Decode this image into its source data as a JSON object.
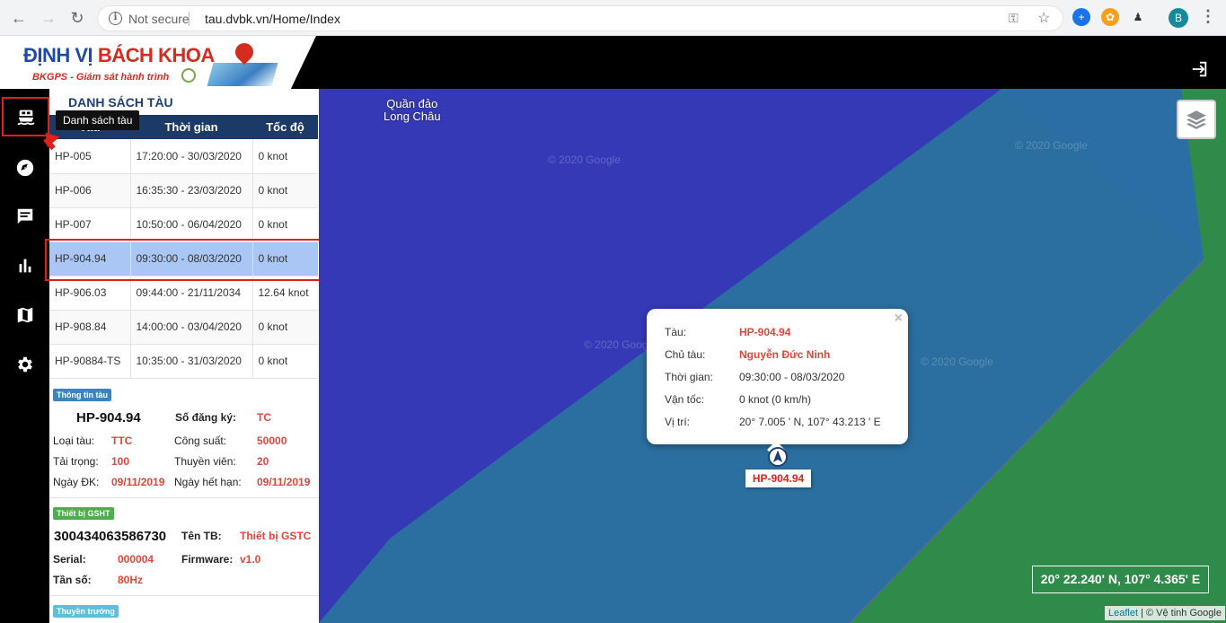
{
  "browser": {
    "security_label": "Not secure",
    "url": "tau.dvbk.vn/Home/Index",
    "avatar_letter": "B"
  },
  "header": {
    "logo_title_1": "ĐỊNH VỊ",
    "logo_title_2": "BÁCH KHOA",
    "logo_subtitle": "BKGPS - Giám sát hành trình"
  },
  "sidebar": {
    "tooltip": "Danh sách tàu",
    "items": [
      {
        "icon": "ship-icon",
        "active": true
      },
      {
        "icon": "compass-icon",
        "active": false
      },
      {
        "icon": "message-icon",
        "active": false
      },
      {
        "icon": "bar-chart-icon",
        "active": false
      },
      {
        "icon": "map-icon",
        "active": false
      },
      {
        "icon": "gear-icon",
        "active": false
      }
    ]
  },
  "ship_list": {
    "title": "DANH SÁCH TÀU",
    "columns": [
      "Tàu",
      "Thời gian",
      "Tốc độ"
    ],
    "rows": [
      {
        "name": "HP-005",
        "time": "17:20:00 - 30/03/2020",
        "speed": "0 knot"
      },
      {
        "name": "HP-006",
        "time": "16:35:30 - 23/03/2020",
        "speed": "0 knot"
      },
      {
        "name": "HP-007",
        "time": "10:50:00 - 06/04/2020",
        "speed": "0 knot"
      },
      {
        "name": "HP-904.94",
        "time": "09:30:00 - 08/03/2020",
        "speed": "0 knot",
        "selected": true
      },
      {
        "name": "HP-906.03",
        "time": "09:44:00 - 21/11/2034",
        "speed": "12.64 knot"
      },
      {
        "name": "HP-908.84",
        "time": "14:00:00 - 03/04/2020",
        "speed": "0 knot"
      },
      {
        "name": "HP-90884-TS",
        "time": "10:35:00 - 31/03/2020",
        "speed": "0 knot"
      }
    ]
  },
  "ship_info": {
    "badge": "Thông tin tàu",
    "ship_name": "HP-904.94",
    "reg_label": "Số đăng ký:",
    "reg_value": "TC",
    "type_label": "Loại tàu:",
    "type_value": "TTC",
    "power_label": "Công suất:",
    "power_value": "50000",
    "load_label": "Tải trọng:",
    "load_value": "100",
    "crew_label": "Thuyền viên:",
    "crew_value": "20",
    "reg_date_label": "Ngày ĐK:",
    "reg_date_value": "09/11/2019",
    "expiry_label": "Ngày hết hạn:",
    "expiry_value": "09/11/2019"
  },
  "device_info": {
    "badge": "Thiết bị GSHT",
    "device_id": "300434063586730",
    "name_label": "Tên TB:",
    "name_value": "Thiết bị GSTC",
    "serial_label": "Serial:",
    "serial_value": "000004",
    "firmware_label": "Firmware:",
    "firmware_value": "v1.0",
    "freq_label": "Tần số:",
    "freq_value": "80Hz"
  },
  "captain": {
    "badge": "Thuyền trưởng"
  },
  "map": {
    "place_label_1": "Quần đảo",
    "place_label_2": "Long Châu",
    "watermark": "© 2020 Google",
    "coordinates": "20° 22.240' N, 107° 4.365' E",
    "attribution_link": "Leaflet",
    "attribution_text": " | © Vệ tinh Google",
    "marker_label": "HP-904.94"
  },
  "popup": {
    "ship_label": "Tàu:",
    "ship_value": "HP-904.94",
    "owner_label": "Chủ tàu:",
    "owner_value": "Nguyễn Đức Ninh",
    "time_label": "Thời gian:",
    "time_value": "09:30:00 - 08/03/2020",
    "speed_label": "Vận tốc:",
    "speed_value": "0 knot (0 km/h)",
    "position_label": "Vị trí:",
    "position_value": "20° 7.005 ' N, 107° 43.213 ' E",
    "close": "×"
  },
  "colors": {
    "header_blue": "#1c3a68",
    "selected_row": "#a9c6f4",
    "accent_red": "#e0201b",
    "sea_deep": "#3539b6",
    "sea_shallow": "#2a6fa0",
    "land": "#2e8b4a"
  }
}
